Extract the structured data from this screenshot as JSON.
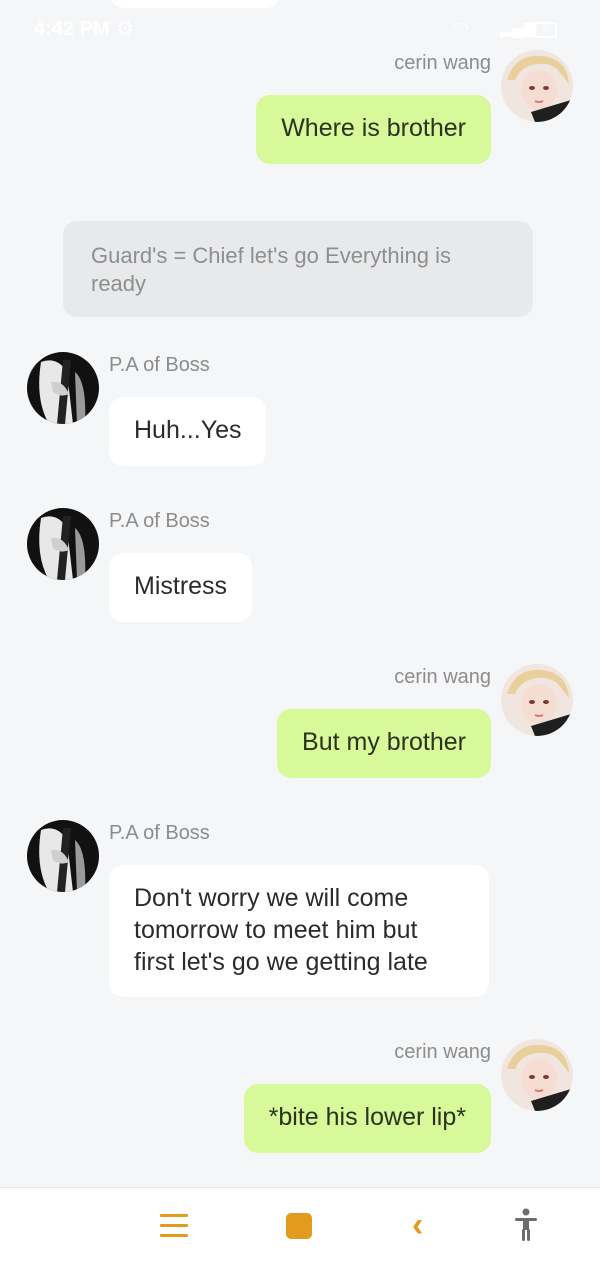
{
  "status_bar": {
    "time": "4:42 PM",
    "battery": "4"
  },
  "narration": "Guard's = Chief let's go Everything is ready",
  "messages": [
    {
      "sender": "cerin wang",
      "text": "Where is brother"
    },
    {
      "sender": "P.A of Boss",
      "text": "Huh...Yes"
    },
    {
      "sender": "P.A of Boss",
      "text": "Mistress"
    },
    {
      "sender": "cerin wang",
      "text": "But my brother"
    },
    {
      "sender": "P.A of Boss",
      "text": "Don't worry we will come tomorrow to meet him but first let's go we getting late"
    },
    {
      "sender": "cerin wang",
      "text": "*bite his lower lip*"
    }
  ],
  "colors": {
    "user_bubble": "#d8f99a",
    "other_bubble": "#ffffff",
    "narration_bubble": "#e8e9eb",
    "nav_accent": "#e29b1d",
    "background": "#f5f6f8"
  },
  "icons": {
    "nav": [
      "menu-icon",
      "home-icon",
      "back-icon",
      "accessibility-icon"
    ]
  }
}
